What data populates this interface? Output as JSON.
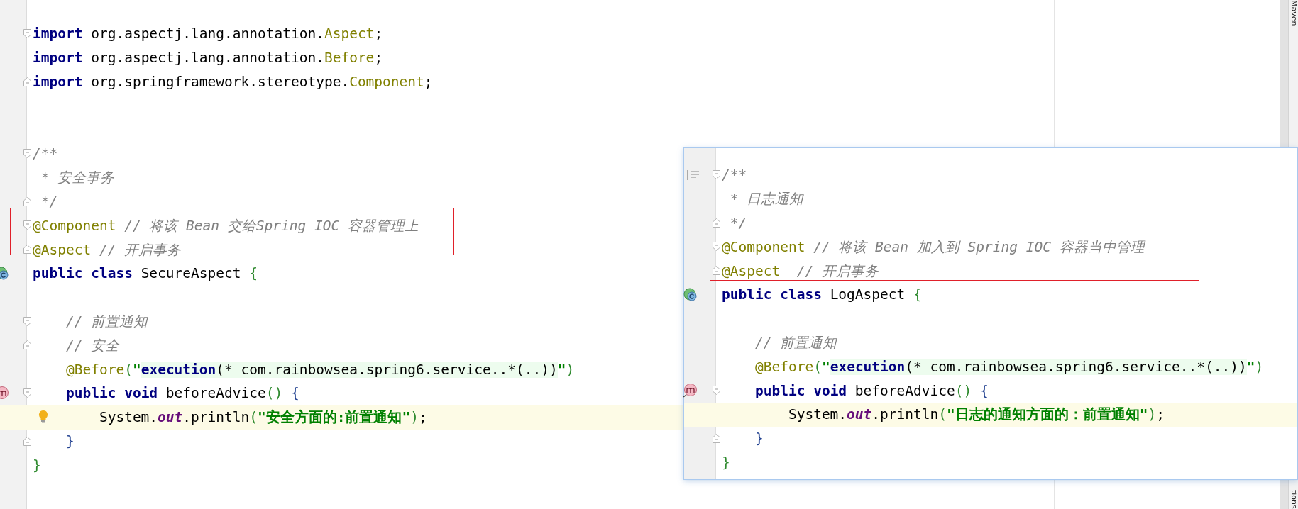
{
  "editor": {
    "lines": [
      {
        "current": false,
        "framed": false,
        "tokens": [
          {
            "kind": "keyword",
            "text": "import"
          },
          {
            "kind": "plain",
            "text": " org.aspectj.lang.annotation."
          },
          {
            "kind": "type",
            "text": "Aspect"
          },
          {
            "kind": "plain",
            "text": ";"
          }
        ]
      },
      {
        "current": false,
        "framed": false,
        "tokens": [
          {
            "kind": "keyword",
            "text": "import"
          },
          {
            "kind": "plain",
            "text": " org.aspectj.lang.annotation."
          },
          {
            "kind": "type",
            "text": "Before"
          },
          {
            "kind": "plain",
            "text": ";"
          }
        ]
      },
      {
        "current": false,
        "framed": false,
        "tokens": [
          {
            "kind": "keyword",
            "text": "import"
          },
          {
            "kind": "plain",
            "text": " org.springframework.stereotype."
          },
          {
            "kind": "type",
            "text": "Component"
          },
          {
            "kind": "plain",
            "text": ";"
          }
        ]
      },
      {
        "current": false,
        "framed": false
      },
      {
        "current": false,
        "framed": false
      },
      {
        "current": false,
        "framed": false,
        "tokens": [
          {
            "kind": "comment",
            "text": "/**"
          }
        ]
      },
      {
        "current": false,
        "framed": false,
        "tokens": [
          {
            "kind": "comment",
            "text": " * 安全事务"
          }
        ]
      },
      {
        "current": false,
        "framed": false,
        "tokens": [
          {
            "kind": "comment",
            "text": " */"
          }
        ]
      },
      {
        "current": false,
        "framed": true,
        "tokens": [
          {
            "kind": "annotation",
            "text": "@Component"
          },
          {
            "kind": "comment",
            "text": " // 将该 Bean 交给Spring IOC 容器管理上"
          }
        ]
      },
      {
        "current": false,
        "framed": true,
        "tokens": [
          {
            "kind": "annotation",
            "text": "@Aspect"
          },
          {
            "kind": "comment",
            "text": " // 开启事务"
          }
        ]
      },
      {
        "current": false,
        "framed": false,
        "tokens": [
          {
            "kind": "keyword",
            "text": "public class"
          },
          {
            "kind": "plain",
            "text": " SecureAspect "
          },
          {
            "kind": "bracket",
            "text": "{"
          }
        ]
      },
      {
        "current": false,
        "framed": false
      },
      {
        "current": false,
        "framed": false,
        "tokens": [
          {
            "kind": "comment",
            "text": "    // 前置通知"
          }
        ]
      },
      {
        "current": false,
        "framed": false,
        "tokens": [
          {
            "kind": "comment",
            "text": "    // 安全"
          }
        ]
      },
      {
        "current": false,
        "framed": false,
        "tokens": [
          {
            "kind": "annotation",
            "text": "    @Before"
          },
          {
            "kind": "bracket",
            "text": "("
          },
          {
            "kind": "string",
            "text": "\""
          },
          {
            "kind": "injection",
            "text": "execution"
          },
          {
            "kind": "pattern",
            "text": "(* com.rainbowsea.spring6.service..*(..))"
          },
          {
            "kind": "string",
            "text": "\""
          },
          {
            "kind": "bracket",
            "text": ")"
          }
        ]
      },
      {
        "current": false,
        "framed": false,
        "tokens": [
          {
            "kind": "keyword",
            "text": "    public void"
          },
          {
            "kind": "plain",
            "text": " beforeAdvice"
          },
          {
            "kind": "bracket",
            "text": "()"
          },
          {
            "kind": "brace",
            "text": " {"
          }
        ]
      },
      {
        "current": true,
        "framed": false,
        "tokens": [
          {
            "kind": "plain",
            "text": "        System."
          },
          {
            "kind": "field",
            "text": "out"
          },
          {
            "kind": "plain",
            "text": ".println"
          },
          {
            "kind": "bracket",
            "text": "("
          },
          {
            "kind": "string",
            "text": "\"安全方面的:前置通知\""
          },
          {
            "kind": "bracket",
            "text": ")"
          },
          {
            "kind": "plain",
            "text": ";"
          }
        ]
      },
      {
        "current": false,
        "framed": false,
        "tokens": [
          {
            "kind": "brace",
            "text": "    }"
          }
        ]
      },
      {
        "current": false,
        "framed": false,
        "tokens": [
          {
            "kind": "bracket",
            "text": "}"
          }
        ]
      }
    ]
  },
  "popup": {
    "lines": [
      {
        "current": false,
        "framed": false,
        "tokens": [
          {
            "kind": "comment",
            "text": "/**"
          }
        ]
      },
      {
        "current": false,
        "framed": false,
        "tokens": [
          {
            "kind": "comment",
            "text": " * 日志通知"
          }
        ]
      },
      {
        "current": false,
        "framed": false,
        "tokens": [
          {
            "kind": "comment",
            "text": " */"
          }
        ]
      },
      {
        "current": false,
        "framed": true,
        "tokens": [
          {
            "kind": "annotation",
            "text": "@Component"
          },
          {
            "kind": "comment",
            "text": " // 将该 Bean 加入到 Spring IOC 容器当中管理"
          }
        ]
      },
      {
        "current": false,
        "framed": true,
        "tokens": [
          {
            "kind": "annotation",
            "text": "@Aspect"
          },
          {
            "kind": "comment",
            "text": "  // 开启事务"
          }
        ]
      },
      {
        "current": false,
        "framed": false,
        "tokens": [
          {
            "kind": "keyword",
            "text": "public class"
          },
          {
            "kind": "plain",
            "text": " LogAspect "
          },
          {
            "kind": "bracket",
            "text": "{"
          }
        ]
      },
      {
        "current": false,
        "framed": false
      },
      {
        "current": false,
        "framed": false,
        "tokens": [
          {
            "kind": "comment",
            "text": "    // 前置通知"
          }
        ]
      },
      {
        "current": false,
        "framed": false,
        "tokens": [
          {
            "kind": "annotation",
            "text": "    @Before"
          },
          {
            "kind": "bracket",
            "text": "("
          },
          {
            "kind": "string",
            "text": "\""
          },
          {
            "kind": "injection",
            "text": "execution"
          },
          {
            "kind": "pattern",
            "text": "(* com.rainbowsea.spring6.service..*(..))"
          },
          {
            "kind": "string",
            "text": "\""
          },
          {
            "kind": "bracket",
            "text": ")"
          }
        ]
      },
      {
        "current": false,
        "framed": false,
        "tokens": [
          {
            "kind": "keyword",
            "text": "    public void"
          },
          {
            "kind": "plain",
            "text": " beforeAdvice"
          },
          {
            "kind": "bracket",
            "text": "()"
          },
          {
            "kind": "brace",
            "text": " {"
          }
        ]
      },
      {
        "current": true,
        "framed": false,
        "tokens": [
          {
            "kind": "plain",
            "text": "        System."
          },
          {
            "kind": "field",
            "text": "out"
          },
          {
            "kind": "plain",
            "text": ".println"
          },
          {
            "kind": "bracket",
            "text": "("
          },
          {
            "kind": "string",
            "text": "\"日志的通知方面的：前置通知\""
          },
          {
            "kind": "bracket",
            "text": ")"
          },
          {
            "kind": "plain",
            "text": ";"
          }
        ]
      },
      {
        "current": false,
        "framed": false,
        "tokens": [
          {
            "kind": "brace",
            "text": "    }"
          }
        ]
      },
      {
        "current": false,
        "framed": false,
        "tokens": [
          {
            "kind": "bracket",
            "text": "}"
          }
        ]
      }
    ]
  },
  "tool_strip": {
    "labels": [
      "Maven",
      "tions"
    ]
  }
}
